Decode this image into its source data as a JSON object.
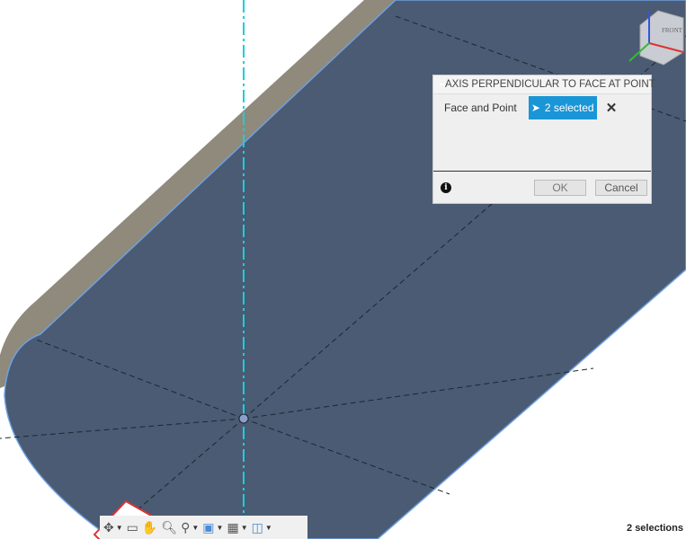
{
  "dialog": {
    "title": "AXIS PERPENDICULAR TO FACE AT POINT",
    "field_label": "Face and Point",
    "selection": "2 selected",
    "ok": "OK",
    "cancel": "Cancel",
    "info": "i"
  },
  "viewcube": {
    "face": "FRONT"
  },
  "toolbar": {
    "items": [
      "orbit-icon",
      "look-at-icon",
      "pan-icon",
      "zoom-window-icon",
      "zoom-icon",
      "display-settings-icon",
      "grid-icon",
      "viewports-icon"
    ]
  },
  "status": {
    "selections": "2 selections"
  },
  "colors": {
    "face": "#4a5b73",
    "selection": "#1a96d6",
    "axis": "#1ad0d8"
  }
}
